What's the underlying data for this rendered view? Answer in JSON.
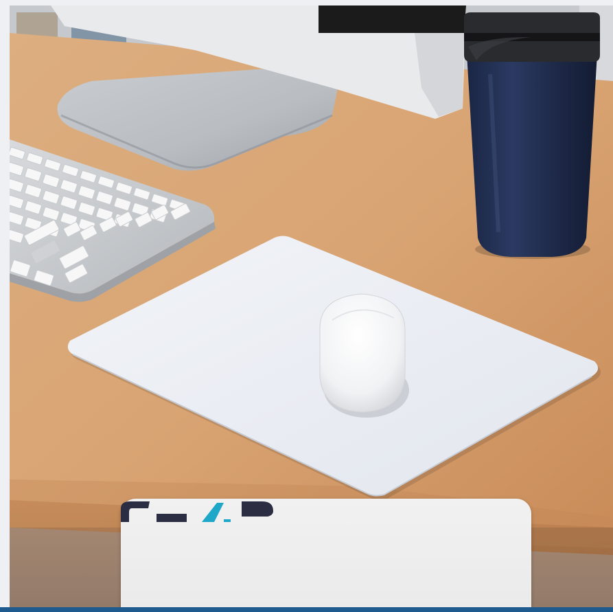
{
  "scene": {
    "objects": [
      "monitor",
      "keyboard",
      "tumbler",
      "mouse-pad",
      "mouse",
      "desk"
    ],
    "colors": {
      "desk": "#d9a675",
      "tumbler": "#1d2a4a",
      "pad": "#e9edf3",
      "bottom_band": "#1f5a8e"
    }
  },
  "card": {
    "logo_icon": "brand-logo-icon",
    "logo_colors": [
      "#2b2d42",
      "#1fa7c9"
    ]
  }
}
